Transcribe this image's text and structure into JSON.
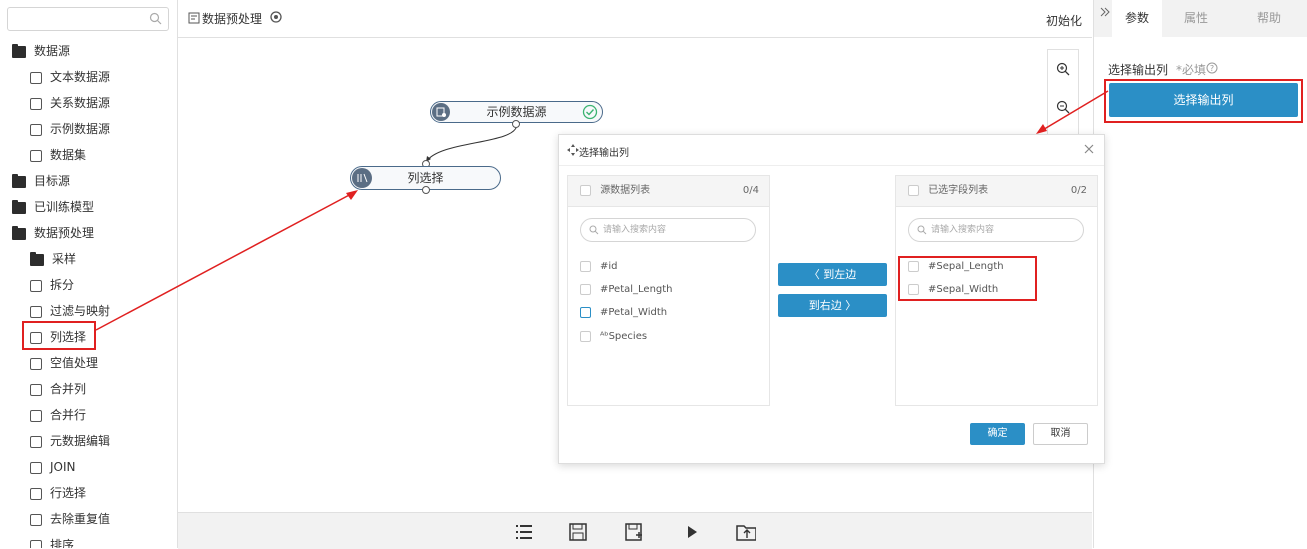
{
  "sidebar": {
    "search_placeholder": "",
    "items": [
      {
        "label": "数据源",
        "icon": "folder-icon"
      },
      {
        "label": "文本数据源",
        "icon": "text-datasource-icon"
      },
      {
        "label": "关系数据源",
        "icon": "relational-datasource-icon"
      },
      {
        "label": "示例数据源",
        "icon": "sample-datasource-icon"
      },
      {
        "label": "数据集",
        "icon": "dataset-icon"
      },
      {
        "label": "目标源",
        "icon": "folder-icon"
      },
      {
        "label": "已训练模型",
        "icon": "folder-icon"
      },
      {
        "label": "数据预处理",
        "icon": "folder-icon"
      },
      {
        "label": "采样",
        "icon": "folder-icon"
      },
      {
        "label": "拆分",
        "icon": "split-icon"
      },
      {
        "label": "过滤与映射",
        "icon": "filter-map-icon"
      },
      {
        "label": "列选择",
        "icon": "column-select-icon"
      },
      {
        "label": "空值处理",
        "icon": "null-handle-icon"
      },
      {
        "label": "合并列",
        "icon": "merge-columns-icon"
      },
      {
        "label": "合并行",
        "icon": "merge-rows-icon"
      },
      {
        "label": "元数据编辑",
        "icon": "metadata-edit-icon"
      },
      {
        "label": "JOIN",
        "icon": "join-icon"
      },
      {
        "label": "行选择",
        "icon": "row-select-icon"
      },
      {
        "label": "去除重复值",
        "icon": "dedupe-icon"
      },
      {
        "label": "排序",
        "icon": "sort-icon"
      }
    ]
  },
  "topbar": {
    "title": "数据预处理",
    "init_label": "初始化"
  },
  "canvas": {
    "node_source": "示例数据源",
    "node_colselect": "列选择"
  },
  "right_panel": {
    "tabs": [
      "参数",
      "属性",
      "帮助"
    ],
    "field_label": "选择输出列",
    "required_label": "*必填",
    "select_button": "选择输出列"
  },
  "dialog": {
    "title": "选择输出列",
    "left_panel": {
      "title": "源数据列表",
      "count": "0/4",
      "search_placeholder": "请输入搜索内容",
      "items": [
        "#id",
        "#Petal_Length",
        "#Petal_Width",
        "ᴬᵇSpecies"
      ]
    },
    "right_panel": {
      "title": "已选字段列表",
      "count": "0/2",
      "search_placeholder": "请输入搜索内容",
      "items": [
        "#Sepal_Length",
        "#Sepal_Width"
      ]
    },
    "to_left": "〈 到左边",
    "to_right": "到右边 〉",
    "ok": "确定",
    "cancel": "取消"
  },
  "colors": {
    "accent": "#2b8fc6",
    "annotation": "#e02020",
    "node_border": "#4a6a8a"
  }
}
